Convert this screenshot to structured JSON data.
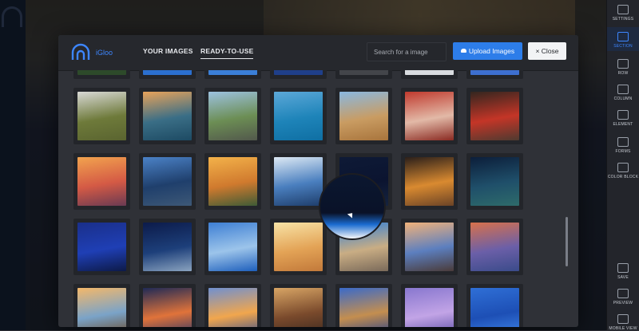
{
  "header": {
    "brand": "iGloo",
    "tabs": [
      {
        "label": "YOUR IMAGES",
        "active": false
      },
      {
        "label": "READY-TO-USE",
        "active": true
      }
    ],
    "search_placeholder": "Search for a image",
    "upload_label": "Upload Images",
    "close_label": "× Close"
  },
  "colors": {
    "accent": "#2d7de9",
    "modal_bg": "#2f3137",
    "header_bg": "#26282d"
  },
  "sidebar": {
    "items": [
      {
        "label": "SETTINGS",
        "icon": "settings-icon"
      },
      {
        "label": "SECTION",
        "icon": "section-icon",
        "active": true
      },
      {
        "label": "ROW",
        "icon": "row-icon"
      },
      {
        "label": "COLUMN",
        "icon": "column-icon"
      },
      {
        "label": "ELEMENT",
        "icon": "element-icon"
      },
      {
        "label": "FORMS",
        "icon": "forms-icon"
      },
      {
        "label": "COLOR BLOCK",
        "icon": "color-block-icon"
      },
      {
        "label": "SAVE",
        "icon": "save-icon"
      },
      {
        "label": "PREVIEW",
        "icon": "preview-icon"
      },
      {
        "label": "MOBILE VIEW",
        "icon": "mobile-view-icon"
      }
    ]
  },
  "images": [
    {
      "name": "dandelion-field",
      "colors": [
        "#d9d9d6",
        "#6e7a3a",
        "#5a6430"
      ]
    },
    {
      "name": "ocean-wave-sunset",
      "colors": [
        "#e8a35a",
        "#3a6e86",
        "#1d4a63"
      ]
    },
    {
      "name": "road-hiker",
      "colors": [
        "#9dc2e0",
        "#6c8e54",
        "#52584c"
      ]
    },
    {
      "name": "tropical-beach",
      "colors": [
        "#5ca8d8",
        "#1e84b9",
        "#0f6fa3"
      ]
    },
    {
      "name": "desert-rocks",
      "colors": [
        "#8ab8e0",
        "#c99c62",
        "#a8743c"
      ]
    },
    {
      "name": "red-train",
      "colors": [
        "#c03a2e",
        "#e2b9a7",
        "#8a2a22"
      ]
    },
    {
      "name": "red-truck",
      "colors": [
        "#33261f",
        "#c43527",
        "#4e3a30"
      ]
    },
    {
      "name": "beach-sunset",
      "colors": [
        "#f2a34e",
        "#d45a45",
        "#6a3a52"
      ]
    },
    {
      "name": "rocky-coast-dusk",
      "colors": [
        "#4b82c7",
        "#1f3f6c",
        "#3d5876"
      ]
    },
    {
      "name": "autumn-river",
      "colors": [
        "#f3b24a",
        "#d07a2e",
        "#3e5b36"
      ]
    },
    {
      "name": "blue-building",
      "colors": [
        "#dde9f4",
        "#4a7fbf",
        "#1e3d6a"
      ]
    },
    {
      "name": "night-shore",
      "colors": [
        "#0e1a36",
        "#0b1430",
        "#15233e"
      ]
    },
    {
      "name": "spice-bowls",
      "colors": [
        "#2a1f1a",
        "#d98a30",
        "#6b4326"
      ]
    },
    {
      "name": "milky-way",
      "colors": [
        "#0c1e3a",
        "#1f4f6a",
        "#2e6b6a"
      ]
    },
    {
      "name": "observatory",
      "colors": [
        "#1a2f8a",
        "#1f3fb5",
        "#0d1a48"
      ]
    },
    {
      "name": "snowy-mountains",
      "colors": [
        "#0c1b4a",
        "#1d3f7a",
        "#8aa3bf"
      ]
    },
    {
      "name": "blue-sky-clouds",
      "colors": [
        "#3e7fd4",
        "#9cc4ea",
        "#1e5fbc"
      ]
    },
    {
      "name": "hand-sunlight",
      "colors": [
        "#f8e3a6",
        "#e3a356",
        "#c2793a"
      ]
    },
    {
      "name": "cliff-town",
      "colors": [
        "#2f7fd9",
        "#c9ad84",
        "#7a6a5a"
      ]
    },
    {
      "name": "sunset-coast-rocks",
      "colors": [
        "#f1b27a",
        "#5c7fbf",
        "#4a3b3a"
      ]
    },
    {
      "name": "golden-gate-beach",
      "colors": [
        "#d7714c",
        "#6b5fa8",
        "#3a4b8a"
      ]
    },
    {
      "name": "girl-sunset",
      "colors": [
        "#f4b86a",
        "#7aa3c8",
        "#6b4a2a"
      ]
    },
    {
      "name": "red-clouds",
      "colors": [
        "#1f2a56",
        "#e0733a",
        "#2c3566"
      ]
    },
    {
      "name": "dusk-sky",
      "colors": [
        "#7090d0",
        "#f1a64d",
        "#3a4f8c"
      ]
    },
    {
      "name": "food-plate",
      "colors": [
        "#d8a565",
        "#7a4a2c",
        "#3a281f"
      ]
    },
    {
      "name": "lighthouse",
      "colors": [
        "#3a6ac9",
        "#c48e4f",
        "#27418a"
      ]
    },
    {
      "name": "purple-haze",
      "colors": [
        "#8877cf",
        "#c2a4e6",
        "#5c4fa6"
      ]
    },
    {
      "name": "blue-gradient",
      "colors": [
        "#2f6fd6",
        "#1d4fb5",
        "#3f85e8"
      ]
    }
  ]
}
